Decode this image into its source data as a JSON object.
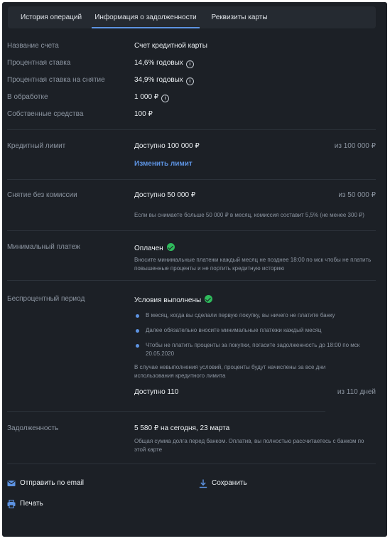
{
  "tabs": [
    {
      "label": "История операций"
    },
    {
      "label": "Информация о задолженности"
    },
    {
      "label": "Реквизиты карты"
    }
  ],
  "account": {
    "name_label": "Название счета",
    "name_value": "Счет кредитной карты",
    "rate_label": "Процентная ставка",
    "rate_value": "14,6% годовых",
    "withdraw_rate_label": "Процентная ставка на снятие",
    "withdraw_rate_value": "34,9% годовых",
    "processing_label": "В обработке",
    "processing_value": "1 000 ₽",
    "own_funds_label": "Собственные средства",
    "own_funds_value": "100 ₽"
  },
  "credit_limit": {
    "label": "Кредитный лимит",
    "available": "Доступно 100 000 ₽",
    "total": "из 100 000 ₽",
    "change_link": "Изменить лимит"
  },
  "withdrawal": {
    "label": "Снятие без комиссии",
    "available": "Доступно 50 000 ₽",
    "total": "из 50 000 ₽",
    "note": "Если вы снимаете больше 50 000 ₽ в месяц, комиссия составит 5,5% (не менее 300 ₽)"
  },
  "min_payment": {
    "label": "Минимальный платеж",
    "status": "Оплачен",
    "note": "Вносите минимальные платежи каждый месяц не позднее 18:00 по мск чтобы не платить повышенные проценты и не портить кредитную историю"
  },
  "grace_period": {
    "label": "Беспроцентный период",
    "status": "Условия выполнены",
    "bullets": [
      "В месяц, когда вы сделали первую покупку, вы ничего не платите банку",
      "Далее обязательно вносите минимальные платежи каждый месяц",
      "Чтобы не платить проценты за покупки, погасите задолженность до 18:00 по мск 20.05.2020"
    ],
    "note": "В случае невыполнения условий, проценты будут начислены за все дни использования кредитного лимита",
    "available": "Доступно 110",
    "total": "из 110 дней"
  },
  "debt": {
    "label": "Задолженность",
    "value": "5 580 ₽ на сегодня, 23 марта",
    "note": "Общая сумма долга перед банком. Оплатив, вы полностью рассчитаетесь с банком по этой карте"
  },
  "actions": {
    "email": "Отправить по email",
    "save": "Сохранить",
    "print": "Печать"
  },
  "colors": {
    "background": "#1c2026",
    "accent": "#5d93e2",
    "success": "#2fbb5c"
  }
}
